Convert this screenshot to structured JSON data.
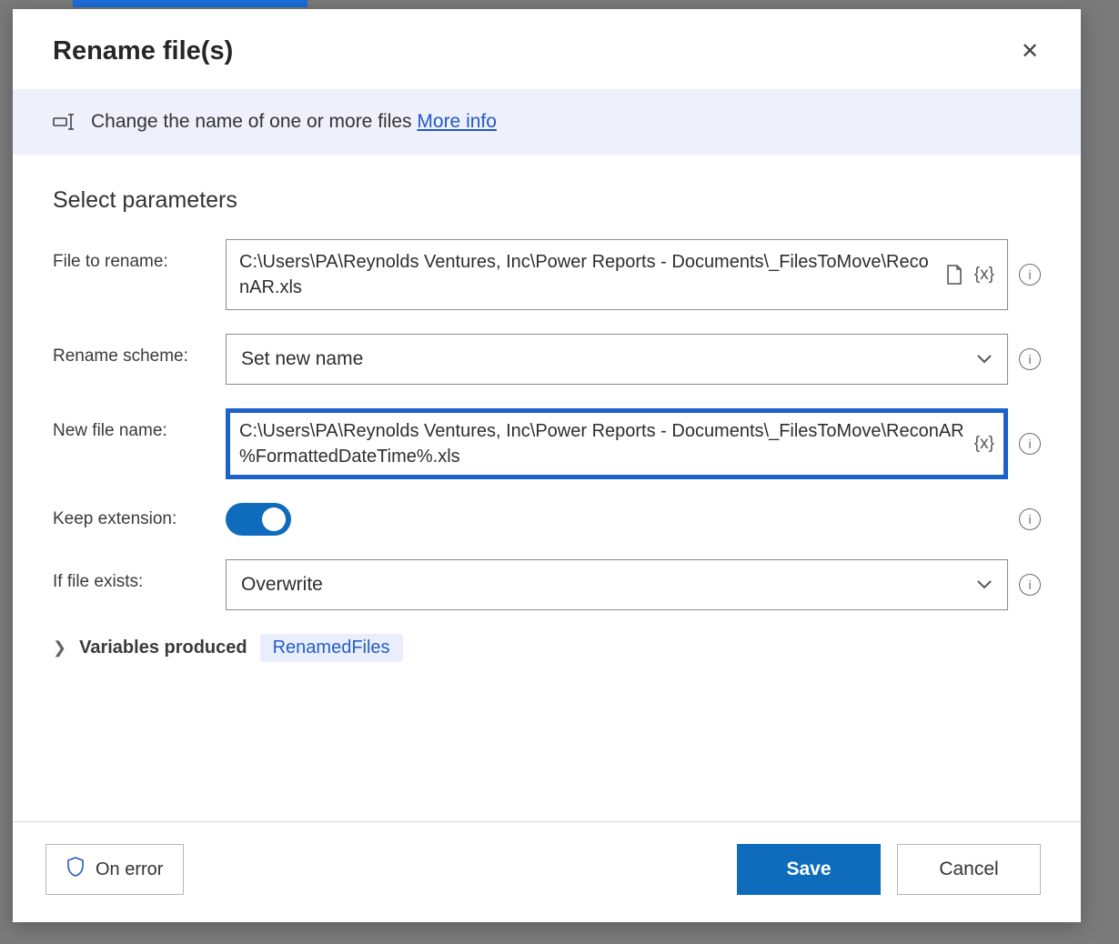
{
  "dialog": {
    "title": "Rename file(s)",
    "banner_text": "Change the name of one or more files",
    "banner_link": "More info",
    "section_title": "Select parameters"
  },
  "fields": {
    "file_to_rename": {
      "label": "File to rename:",
      "value": "C:\\Users\\PA\\Reynolds Ventures, Inc\\Power Reports - Documents\\_FilesToMove\\ReconAR.xls"
    },
    "rename_scheme": {
      "label": "Rename scheme:",
      "value": "Set new name"
    },
    "new_file_name": {
      "label": "New file name:",
      "value": "C:\\Users\\PA\\Reynolds Ventures, Inc\\Power Reports - Documents\\_FilesToMove\\ReconAR %FormattedDateTime%.xls"
    },
    "keep_extension": {
      "label": "Keep extension:",
      "value": true
    },
    "if_file_exists": {
      "label": "If file exists:",
      "value": "Overwrite"
    }
  },
  "variables": {
    "label": "Variables produced",
    "chip": "RenamedFiles"
  },
  "footer": {
    "on_error": "On error",
    "save": "Save",
    "cancel": "Cancel"
  },
  "icons": {
    "variable": "{x}"
  }
}
